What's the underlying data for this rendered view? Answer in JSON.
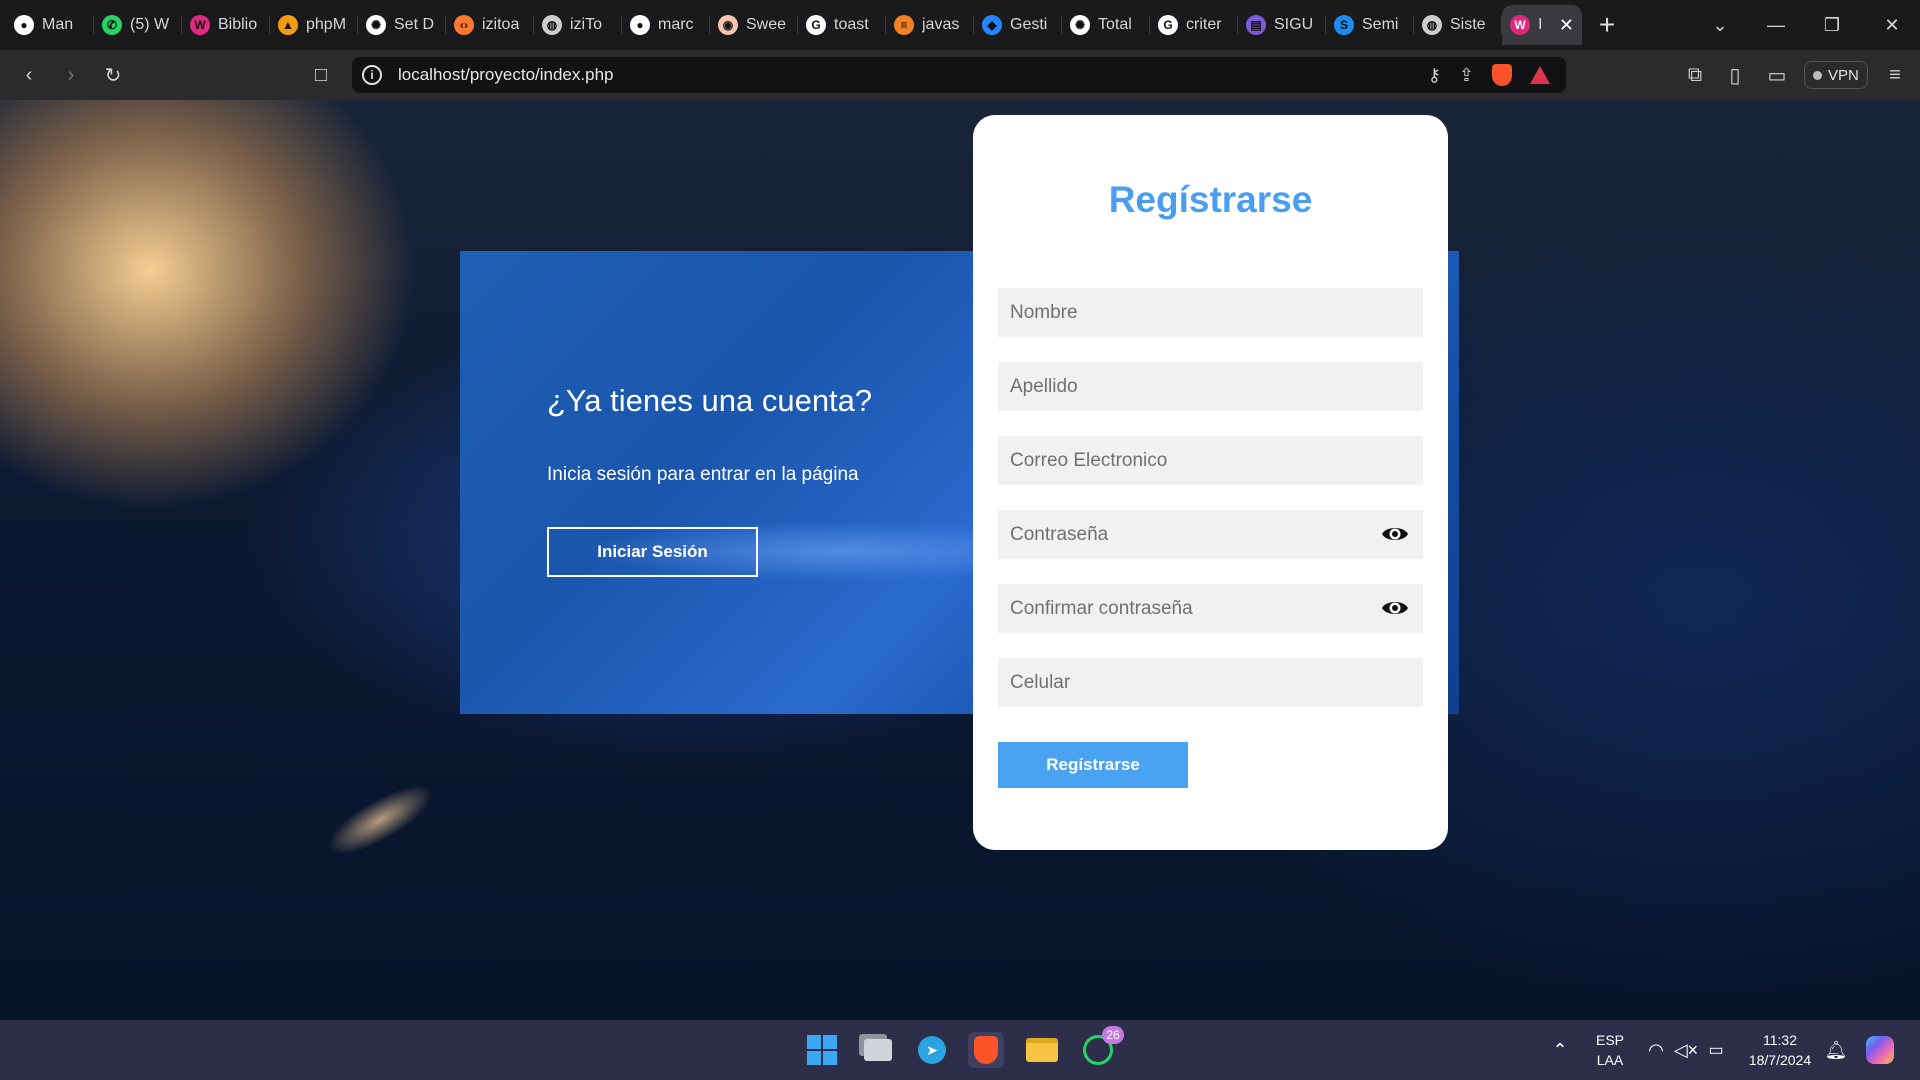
{
  "browser": {
    "tabs": [
      {
        "title": "Man",
        "icon": "github-icon",
        "color": "#ffffff"
      },
      {
        "title": "(5) W",
        "icon": "whatsapp-icon",
        "color": "#25d366"
      },
      {
        "title": "Biblio",
        "icon": "wix-icon",
        "color": "#e0287f"
      },
      {
        "title": "phpM",
        "icon": "phpmyadmin-icon",
        "color": "#f39c12"
      },
      {
        "title": "Set D",
        "icon": "openai-icon",
        "color": "#ffffff"
      },
      {
        "title": "izitoa",
        "icon": "code-icon",
        "color": "#ff7a2f"
      },
      {
        "title": "iziTo",
        "icon": "globe-icon",
        "color": "#cccccc"
      },
      {
        "title": "marc",
        "icon": "github-icon",
        "color": "#ffffff"
      },
      {
        "title": "Swee",
        "icon": "sweetalert-icon",
        "color": "#f8c5b0"
      },
      {
        "title": "toast",
        "icon": "google-icon",
        "color": "#ffffff"
      },
      {
        "title": "javas",
        "icon": "stackoverflow-icon",
        "color": "#f48024"
      },
      {
        "title": "Gesti",
        "icon": "jira-icon",
        "color": "#2684ff"
      },
      {
        "title": "Total",
        "icon": "openai-icon",
        "color": "#ffffff"
      },
      {
        "title": "criter",
        "icon": "google-icon",
        "color": "#ffffff"
      },
      {
        "title": "SIGU",
        "icon": "sigu-icon",
        "color": "#7b5cd6"
      },
      {
        "title": "Semi",
        "icon": "skype-icon",
        "color": "#1d8cf0"
      },
      {
        "title": "Siste",
        "icon": "globe-icon",
        "color": "#cccccc"
      }
    ],
    "active_tab": {
      "title": "I",
      "icon": "wix-icon",
      "color": "#e0287f",
      "close": "✕"
    },
    "new_tab": "+",
    "url": "localhost/proyecto/index.php",
    "vpn_label": "VPN"
  },
  "page": {
    "left_panel": {
      "title": "¿Ya tienes una cuenta?",
      "subtitle": "Inicia sesión para entrar en la página",
      "button": "Iniciar Sesión"
    },
    "register": {
      "title": "Regístrarse",
      "fields": {
        "nombre": "Nombre",
        "apellido": "Apellido",
        "correo": "Correo Electronico",
        "contrasena": "Contraseña",
        "confirmar": "Confirmar contraseña",
        "celular": "Celular"
      },
      "submit": "Regístrarse"
    },
    "colors": {
      "accent": "#4a9ef0",
      "panel_blue": "#1e5fb4",
      "button_blue": "#4aa3f2"
    }
  },
  "taskbar": {
    "whatsapp_badge": "26",
    "lang_top": "ESP",
    "lang_bottom": "LAA",
    "time": "11:32",
    "date": "18/7/2024"
  }
}
